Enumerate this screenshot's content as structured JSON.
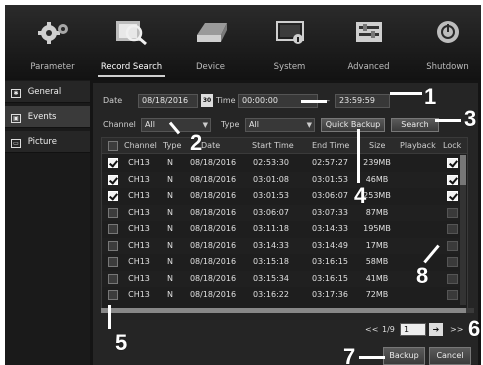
{
  "nav": {
    "items": [
      {
        "label": "Parameter",
        "icon": "gears-icon"
      },
      {
        "label": "Record Search",
        "icon": "search-folder-icon"
      },
      {
        "label": "Device",
        "icon": "hard-drive-icon"
      },
      {
        "label": "System",
        "icon": "system-info-icon"
      },
      {
        "label": "Advanced",
        "icon": "advanced-settings-icon"
      },
      {
        "label": "Shutdown",
        "icon": "power-icon"
      }
    ],
    "active": "Record Search"
  },
  "sidebar": {
    "items": [
      {
        "label": "General",
        "icon": "general-icon"
      },
      {
        "label": "Events",
        "icon": "events-icon"
      },
      {
        "label": "Picture",
        "icon": "picture-icon"
      }
    ]
  },
  "filters": {
    "date_label": "Date",
    "date_value": "08/18/2016",
    "calendar_icon_text": "30",
    "time_label": "Time",
    "time_from": "00:00:00",
    "time_sep": "—",
    "time_to": "23:59:59",
    "channel_label": "Channel",
    "channel_value": "All",
    "type_label": "Type",
    "type_value": "All",
    "quick_backup_label": "Quick Backup",
    "search_label": "Search"
  },
  "table": {
    "headers": [
      "Channel",
      "Type",
      "Date",
      "Start Time",
      "End Time",
      "Size",
      "Playback",
      "Lock"
    ],
    "rows": [
      {
        "checked": true,
        "channel": "CH13",
        "type": "N",
        "date": "08/18/2016",
        "start": "02:53:30",
        "end": "02:57:27",
        "size": "239MB",
        "locked": true
      },
      {
        "checked": true,
        "channel": "CH13",
        "type": "N",
        "date": "08/18/2016",
        "start": "03:01:08",
        "end": "03:01:53",
        "size": "46MB",
        "locked": true
      },
      {
        "checked": true,
        "channel": "CH13",
        "type": "N",
        "date": "08/18/2016",
        "start": "03:01:53",
        "end": "03:06:07",
        "size": "253MB",
        "locked": true
      },
      {
        "checked": false,
        "channel": "CH13",
        "type": "N",
        "date": "08/18/2016",
        "start": "03:06:07",
        "end": "03:07:33",
        "size": "87MB",
        "locked": false
      },
      {
        "checked": false,
        "channel": "CH13",
        "type": "N",
        "date": "08/18/2016",
        "start": "03:11:18",
        "end": "03:14:33",
        "size": "195MB",
        "locked": false
      },
      {
        "checked": false,
        "channel": "CH13",
        "type": "N",
        "date": "08/18/2016",
        "start": "03:14:33",
        "end": "03:14:49",
        "size": "17MB",
        "locked": false
      },
      {
        "checked": false,
        "channel": "CH13",
        "type": "N",
        "date": "08/18/2016",
        "start": "03:15:18",
        "end": "03:16:15",
        "size": "58MB",
        "locked": false
      },
      {
        "checked": false,
        "channel": "CH13",
        "type": "N",
        "date": "08/18/2016",
        "start": "03:15:34",
        "end": "03:16:15",
        "size": "41MB",
        "locked": false
      },
      {
        "checked": false,
        "channel": "CH13",
        "type": "N",
        "date": "08/18/2016",
        "start": "03:16:22",
        "end": "03:17:36",
        "size": "72MB",
        "locked": false
      }
    ]
  },
  "pagination": {
    "first": "<<",
    "current": "1/9",
    "page_input": "1",
    "last": ">>"
  },
  "actions": {
    "backup_label": "Backup",
    "cancel_label": "Cancel"
  },
  "callouts": [
    "1",
    "2",
    "3",
    "4",
    "5",
    "6",
    "7",
    "8"
  ]
}
